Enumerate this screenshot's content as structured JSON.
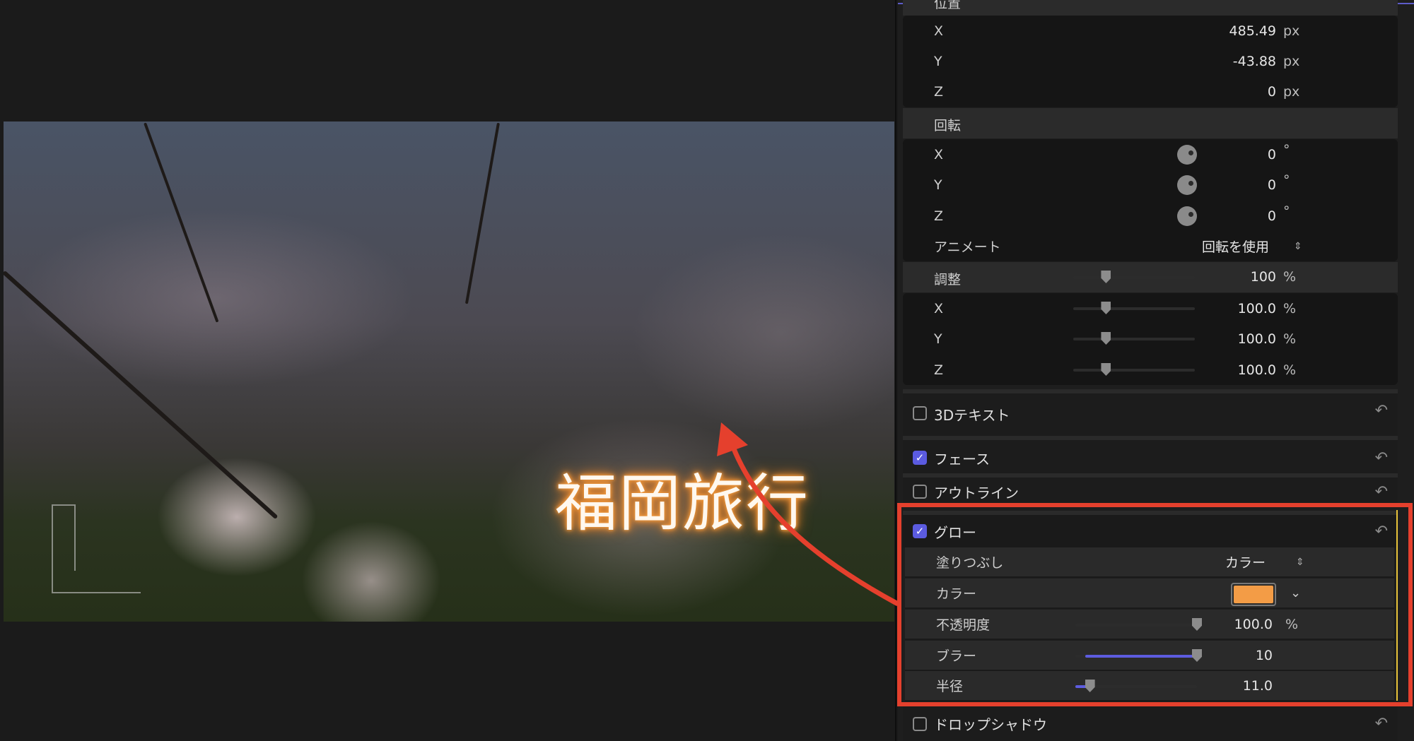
{
  "viewer": {
    "title_text": "福岡旅行",
    "glow_color": "#f39a3c"
  },
  "inspector": {
    "position": {
      "label": "位置",
      "rows": [
        {
          "axis": "X",
          "value": "485.49",
          "unit": "px"
        },
        {
          "axis": "Y",
          "value": "-43.88",
          "unit": "px"
        },
        {
          "axis": "Z",
          "value": "0",
          "unit": "px"
        }
      ]
    },
    "rotation": {
      "label": "回転",
      "rows": [
        {
          "axis": "X",
          "value": "0",
          "unit": "°"
        },
        {
          "axis": "Y",
          "value": "0",
          "unit": "°"
        },
        {
          "axis": "Z",
          "value": "0",
          "unit": "°"
        }
      ],
      "animate_label": "アニメート",
      "animate_value": "回転を使用"
    },
    "scale": {
      "label": "調整",
      "value": "100",
      "unit": "%",
      "slider": 0.27,
      "rows": [
        {
          "axis": "X",
          "value": "100.0",
          "unit": "%",
          "slider": 0.27
        },
        {
          "axis": "Y",
          "value": "100.0",
          "unit": "%",
          "slider": 0.27
        },
        {
          "axis": "Z",
          "value": "100.0",
          "unit": "%",
          "slider": 0.27
        }
      ]
    },
    "sections": {
      "text3d": {
        "label": "3Dテキスト",
        "checked": false
      },
      "face": {
        "label": "フェース",
        "checked": true
      },
      "outline": {
        "label": "アウトライン",
        "checked": false
      },
      "glow": {
        "label": "グロー",
        "checked": true
      },
      "drop_shadow": {
        "label": "ドロップシャドウ",
        "checked": false
      }
    },
    "glow": {
      "fill_label": "塗りつぶし",
      "fill_value": "カラー",
      "color_label": "カラー",
      "color": "#f39c46",
      "opacity_label": "不透明度",
      "opacity_value": "100.0",
      "opacity_unit": "%",
      "opacity_slider": 1.0,
      "blur_label": "ブラー",
      "blur_value": "10",
      "blur_slider": 1.0,
      "radius_label": "半径",
      "radius_value": "11.0",
      "radius_slider": 0.12
    },
    "check_glyph": "✓",
    "reset_glyph": "↶",
    "updown_glyph": "⌃⌄",
    "chevron_glyph": "⌄"
  },
  "annotation": {
    "color": "#e5402d"
  }
}
